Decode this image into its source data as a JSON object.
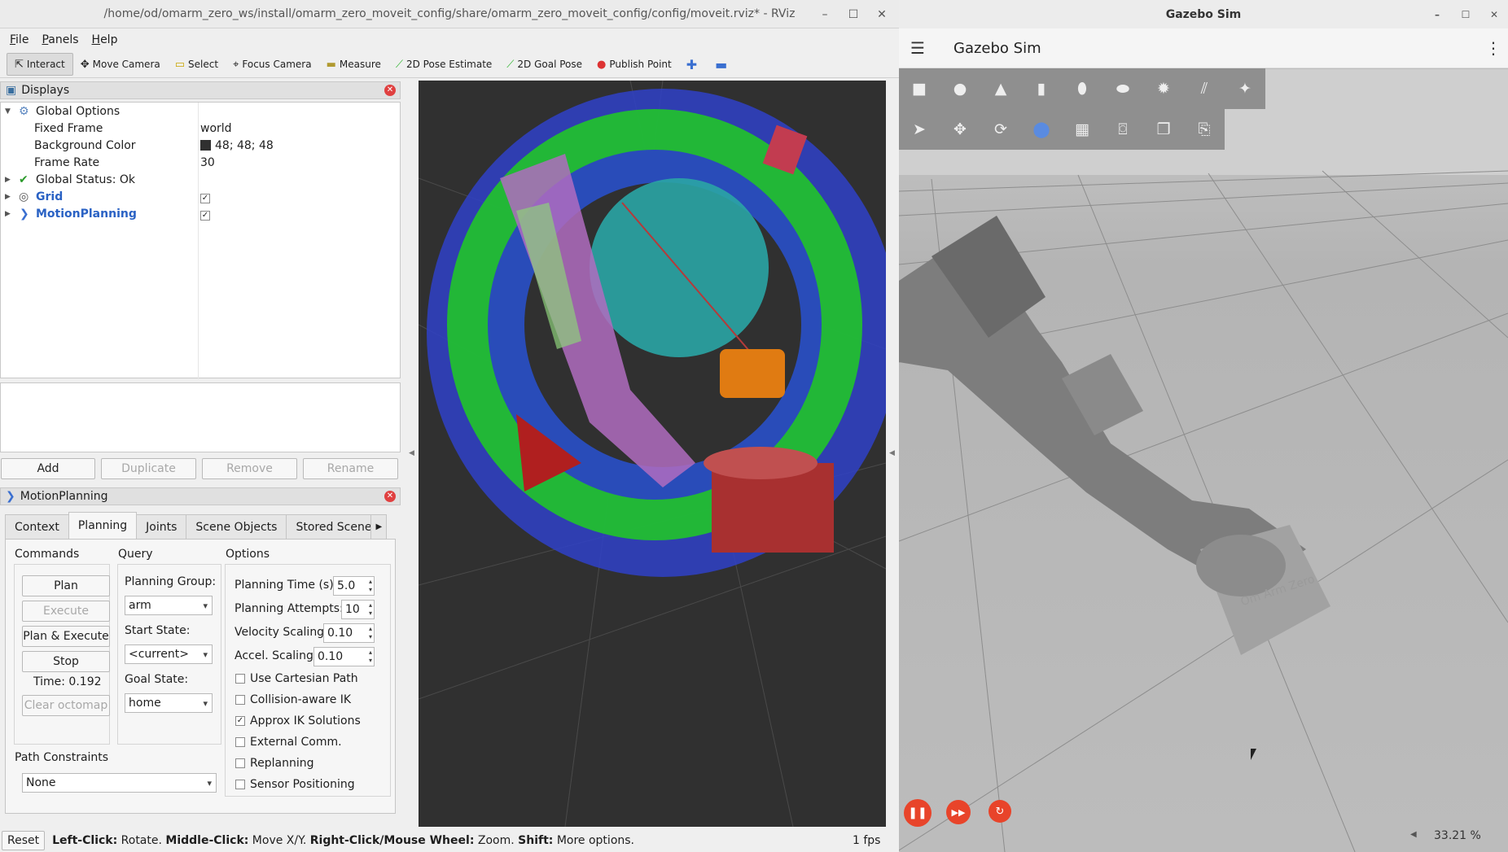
{
  "rviz": {
    "window_title": "/home/od/omarm_zero_ws/install/omarm_zero_moveit_config/share/omarm_zero_moveit_config/config/moveit.rviz* - RViz",
    "menus": [
      "File",
      "Panels",
      "Help"
    ],
    "toolbar": [
      {
        "label": "Interact",
        "icon": "cursor-icon",
        "active": true
      },
      {
        "label": "Move Camera",
        "icon": "move-icon"
      },
      {
        "label": "Select",
        "icon": "select-box-icon"
      },
      {
        "label": "Focus Camera",
        "icon": "target-icon"
      },
      {
        "label": "Measure",
        "icon": "ruler-icon"
      },
      {
        "label": "2D Pose Estimate",
        "icon": "green-arrow-icon"
      },
      {
        "label": "2D Goal Pose",
        "icon": "green-arrow-icon"
      },
      {
        "label": "Publish Point",
        "icon": "map-pin-icon"
      }
    ],
    "displays": {
      "title": "Displays",
      "global_options": "Global Options",
      "fixed_frame_label": "Fixed Frame",
      "fixed_frame_value": "world",
      "bg_color_label": "Background Color",
      "bg_color_value": "48; 48; 48",
      "frame_rate_label": "Frame Rate",
      "frame_rate_value": "30",
      "global_status": "Global Status: Ok",
      "grid": "Grid",
      "motion_planning": "MotionPlanning"
    },
    "display_buttons": {
      "add": "Add",
      "duplicate": "Duplicate",
      "remove": "Remove",
      "rename": "Rename"
    },
    "mp": {
      "title": "MotionPlanning",
      "tabs": [
        "Context",
        "Planning",
        "Joints",
        "Scene Objects",
        "Stored Scene"
      ],
      "active_tab": "Planning",
      "commands_label": "Commands",
      "query_label": "Query",
      "options_label": "Options",
      "plan": "Plan",
      "execute": "Execute",
      "plan_execute": "Plan & Execute",
      "stop": "Stop",
      "time": "Time: 0.192",
      "clear_octomap": "Clear octomap",
      "planning_group_label": "Planning Group:",
      "planning_group_value": "arm",
      "start_state_label": "Start State:",
      "start_state_value": "<current>",
      "goal_state_label": "Goal State:",
      "goal_state_value": "home",
      "planning_time_label": "Planning Time (s):",
      "planning_time_value": "5.0",
      "planning_attempts_label": "Planning Attempts:",
      "planning_attempts_value": "10",
      "velocity_label": "Velocity Scaling:",
      "velocity_value": "0.10",
      "accel_label": "Accel. Scaling:",
      "accel_value": "0.10",
      "use_cartesian": "Use Cartesian Path",
      "collision_ik": "Collision-aware IK",
      "approx_ik": "Approx IK Solutions",
      "external_comm": "External Comm.",
      "replanning": "Replanning",
      "sensor_positioning": "Sensor Positioning",
      "path_constraints_label": "Path Constraints",
      "path_constraints_value": "None"
    },
    "status": {
      "reset": "Reset",
      "hint_left_key": "Left-Click:",
      "hint_left": " Rotate. ",
      "hint_mid_key": "Middle-Click:",
      "hint_mid": " Move X/Y. ",
      "hint_right_key": "Right-Click/Mouse Wheel:",
      "hint_right": " Zoom. ",
      "hint_shift_key": "Shift:",
      "hint_shift": " More options.",
      "fps": "1 fps"
    }
  },
  "gazebo": {
    "window_title": "Gazebo Sim",
    "app_title": "Gazebo Sim",
    "shape_tools": [
      "box-icon",
      "sphere-icon",
      "cone-icon",
      "cylinder-icon",
      "capsule-icon",
      "ellipsoid-icon",
      "sun-light-icon",
      "directional-light-icon",
      "spot-light-icon"
    ],
    "transform_tools": [
      "select-arrow-icon",
      "translate-icon",
      "rotate-icon",
      "snap-icon",
      "grid-icon",
      "camera-icon",
      "copy-icon",
      "paste-icon"
    ],
    "rtf": "33.21 %",
    "base_label": "Om Arm Zero"
  },
  "colors": {
    "accent_red": "#e8442a",
    "viewport_bg": "#303030",
    "tree_blue": "#2a62c4"
  }
}
